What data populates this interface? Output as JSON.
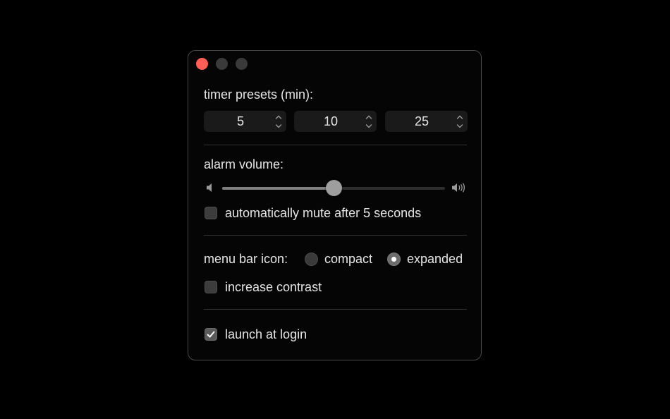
{
  "window": {
    "controls": [
      "close",
      "minimize",
      "zoom"
    ]
  },
  "timer_presets": {
    "label": "timer presets (min):",
    "values": [
      "5",
      "10",
      "25"
    ]
  },
  "alarm": {
    "label": "alarm volume:",
    "volume_fraction": 0.5,
    "min_icon": "speaker-low-icon",
    "max_icon": "speaker-high-icon",
    "auto_mute": {
      "label": "automatically mute after 5 seconds",
      "checked": false
    }
  },
  "menu_bar_icon": {
    "label": "menu bar icon:",
    "options": [
      {
        "label": "compact",
        "selected": false
      },
      {
        "label": "expanded",
        "selected": true
      }
    ],
    "increase_contrast": {
      "label": "increase contrast",
      "checked": false
    }
  },
  "launch_at_login": {
    "label": "launch at login",
    "checked": true
  },
  "colors": {
    "close": "#ff5f57",
    "inactive_control": "#3a3a3a",
    "background": "#050505",
    "accent": "#808080"
  }
}
